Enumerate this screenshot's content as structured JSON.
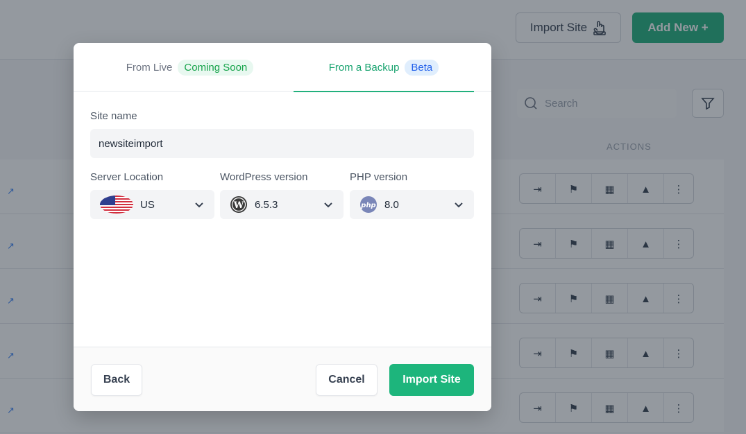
{
  "background": {
    "header": {
      "import_site_label": "Import Site",
      "add_new_label": "Add New +"
    },
    "search_placeholder": "Search",
    "actions_column_header": "ACTIONS",
    "row_count": 5
  },
  "modal": {
    "tabs": [
      {
        "label": "From Live",
        "badge": "Coming Soon",
        "active": false
      },
      {
        "label": "From a Backup",
        "badge": "Beta",
        "active": true
      }
    ],
    "site_name": {
      "label": "Site name",
      "value": "newsiteimport"
    },
    "server_location": {
      "label": "Server Location",
      "value": "US",
      "icon": "us-flag-icon"
    },
    "wordpress_version": {
      "label": "WordPress version",
      "value": "6.5.3",
      "icon": "wordpress-icon"
    },
    "php_version": {
      "label": "PHP version",
      "value": "8.0",
      "icon": "php-icon"
    },
    "footer": {
      "back_label": "Back",
      "cancel_label": "Cancel",
      "import_label": "Import Site"
    }
  },
  "colors": {
    "accent_green": "#1db57c",
    "beta_badge": "#2563eb",
    "coming_soon_badge": "#16a34a"
  }
}
